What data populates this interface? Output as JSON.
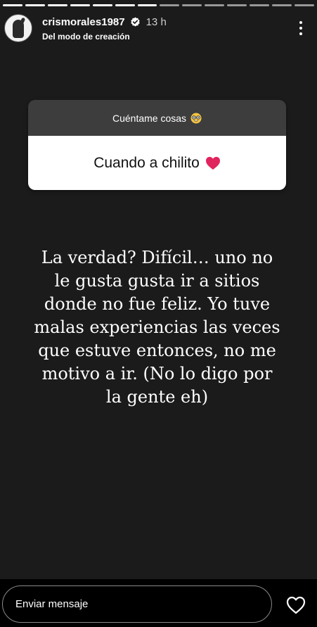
{
  "story": {
    "segments": 14,
    "active_segment": 6,
    "user": {
      "username": "crismorales1987",
      "time": "13 h",
      "subtitle": "Del modo de creación"
    },
    "question_box": {
      "prompt": "Cuéntame cosas",
      "prompt_emoji": "nerd-face-icon",
      "answer": "Cuando a chilito",
      "answer_emoji": "red-heart-icon"
    },
    "text": "La verdad? Difícil… uno no\nle gusta gusta ir a sitios\ndonde no fue feliz. Yo tuve\nmalas experiencias las veces\nque estuve entonces, no me\nmotivo a ir. (No lo digo por\nla gente eh)",
    "colors": {
      "background": "#1b1b1b",
      "question_header": "#3d3d3d",
      "question_answer": "#ffffff",
      "heart": "#e0245e"
    }
  },
  "footer": {
    "message_placeholder": "Enviar mensaje"
  }
}
